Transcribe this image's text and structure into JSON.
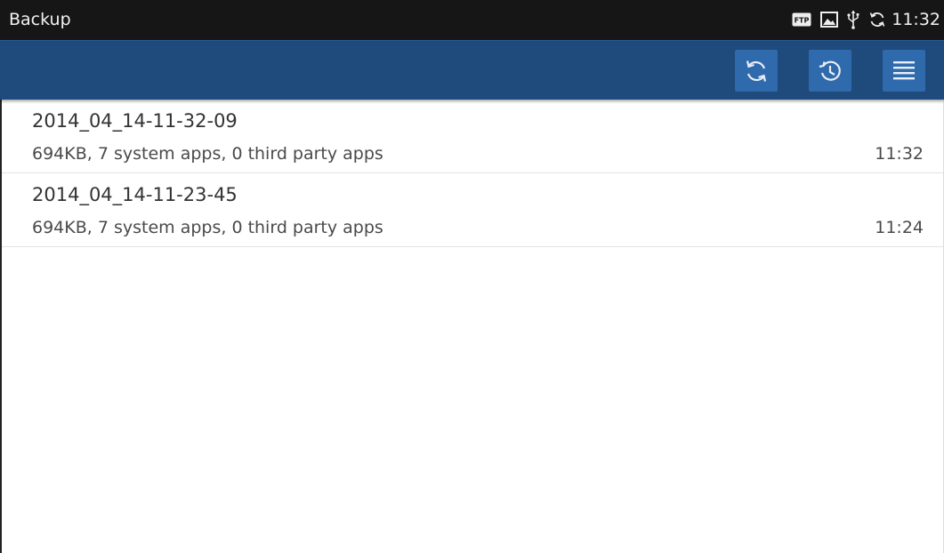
{
  "status_bar": {
    "title": "Backup",
    "time": "11:32",
    "icons": [
      "ftp-icon",
      "image-icon",
      "usb-icon",
      "sync-icon"
    ],
    "ftp_label": "FTP"
  },
  "action_bar": {
    "buttons": [
      "refresh-icon",
      "restore-history-icon",
      "menu-icon"
    ],
    "color": "#1f4a7c",
    "button_color": "#2f6aad"
  },
  "backups": [
    {
      "name": "2014_04_14-11-32-09",
      "details": "694KB, 7 system apps, 0 third party apps",
      "time": "11:32"
    },
    {
      "name": "2014_04_14-11-23-45",
      "details": "694KB, 7 system apps, 0 third party apps",
      "time": "11:24"
    }
  ]
}
